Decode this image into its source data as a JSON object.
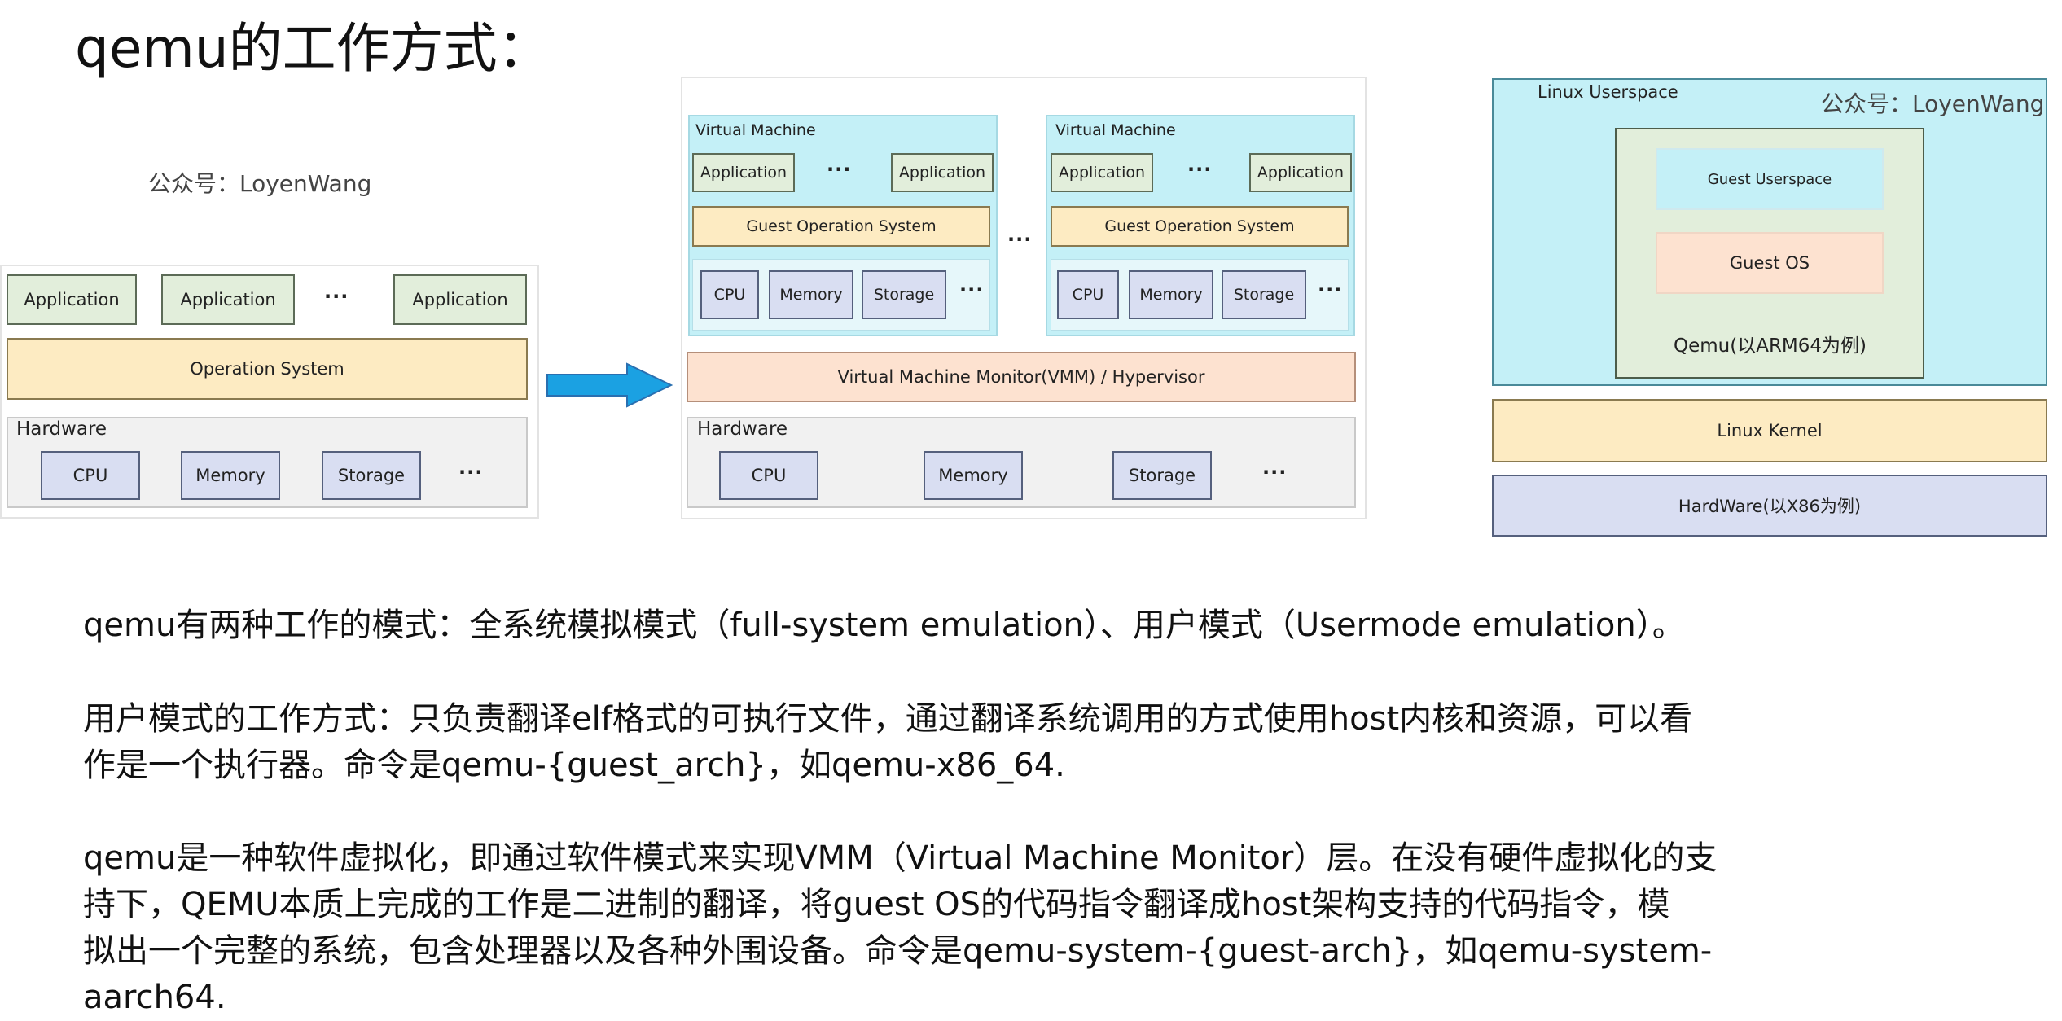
{
  "title": "qemu的工作方式：",
  "watermark": "公众号：LoyenWang",
  "native": {
    "applications": [
      "Application",
      "Application",
      "Application"
    ],
    "ellipsis": "···",
    "os": "Operation System",
    "hardware_label": "Hardware",
    "hardware_items": [
      "CPU",
      "Memory",
      "Storage"
    ]
  },
  "virt": {
    "vm_label": "Virtual Machine",
    "app": "Application",
    "guest_os": "Guest Operation System",
    "chips": [
      "CPU",
      "Memory",
      "Storage"
    ],
    "vmm": "Virtual Machine Monitor(VMM) / Hypervisor",
    "hardware_label": "Hardware",
    "hardware_items": [
      "CPU",
      "Memory",
      "Storage"
    ]
  },
  "user": {
    "userspace_label": "Linux Userspace",
    "watermark": "公众号：LoyenWang",
    "guest_userspace": "Guest Userspace",
    "guest_os": "Guest OS",
    "qemu": "Qemu(以ARM64为例)",
    "kernel": "Linux Kernel",
    "hardware": "HardWare(以X86为例)"
  },
  "text": {
    "p1": "qemu有两种工作的模式：全系统模拟模式（full-system emulation）、用户模式（Usermode emulation）。",
    "p2_l1": "用户模式的工作方式：只负责翻译elf格式的可执行文件，通过翻译系统调用的方式使用host内核和资源，可以看",
    "p2_l2": "作是一个执行器。命令是qemu-{guest_arch}，如qemu-x86_64.",
    "p3_l1": "qemu是一种软件虚拟化，即通过软件模式来实现VMM（Virtual Machine Monitor）层。在没有硬件虚拟化的支",
    "p3_l2": "持下，QEMU本质上完成的工作是二进制的翻译，将guest OS的代码指令翻译成host架构支持的代码指令，模",
    "p3_l3": "拟出一个完整的系统，包含处理器以及各种外围设备。命令是qemu-system-{guest-arch}，如qemu-system-",
    "p3_l4": "aarch64."
  }
}
